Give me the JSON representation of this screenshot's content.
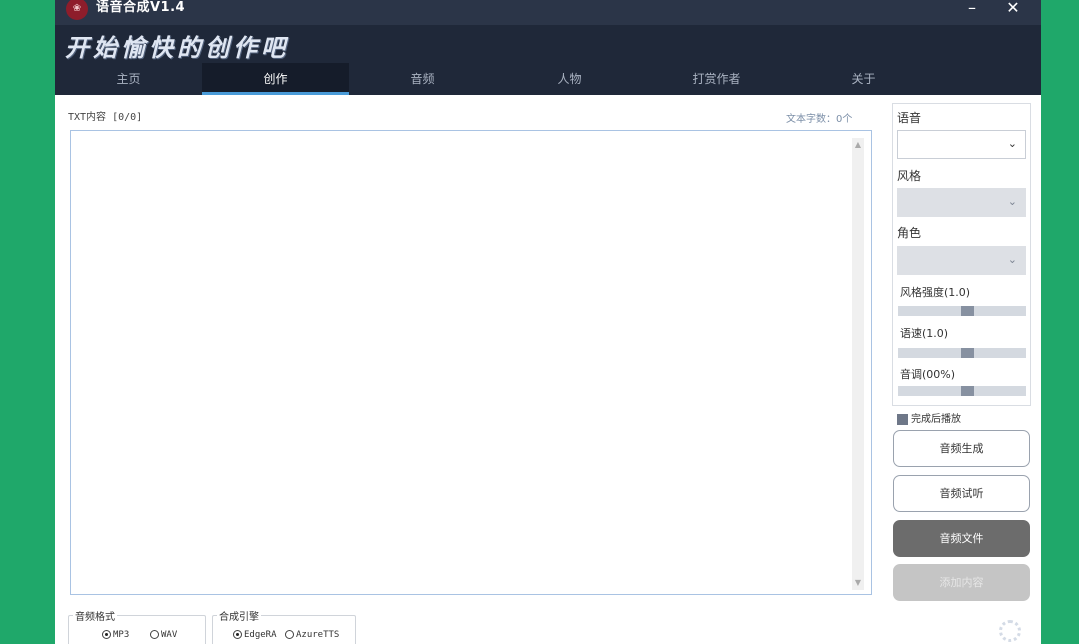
{
  "window": {
    "logo_text": "❀",
    "title": "语音合成V1.4",
    "minimize_label": "–",
    "close_label": "✕",
    "slogan": "开始愉快的创作吧"
  },
  "tabs": [
    {
      "label": "主页",
      "active": false
    },
    {
      "label": "创作",
      "active": true
    },
    {
      "label": "音频",
      "active": false
    },
    {
      "label": "人物",
      "active": false
    },
    {
      "label": "打赏作者",
      "active": false
    },
    {
      "label": "关于",
      "active": false
    }
  ],
  "editor": {
    "txt_label": "TXT内容  [0/0]",
    "char_count": "文本字数：0个",
    "content": ""
  },
  "panel": {
    "voice_label": "语音",
    "voice_value": "",
    "style_label": "风格",
    "style_value": "",
    "role_label": "角色",
    "role_value": "",
    "style_strength_label": "风格强度(1.0)",
    "style_strength_level": 0.54,
    "speed_label": "语速(1.0)",
    "speed_level": 0.54,
    "pitch_label": "音调(00%)",
    "pitch_level": 0.54,
    "play_after_label": "完成后播放",
    "play_after_checked": true
  },
  "buttons": {
    "generate": "音频生成",
    "preview": "音频试听",
    "audio_file": "音频文件",
    "add_content": "添加内容"
  },
  "audio_format": {
    "title": "音频格式",
    "options": [
      {
        "label": "MP3",
        "checked": true
      },
      {
        "label": "WAV",
        "checked": false
      }
    ]
  },
  "engine": {
    "title": "合成引擎",
    "options": [
      {
        "label": "EdgeRA",
        "checked": true
      },
      {
        "label": "AzureTTS",
        "checked": false
      }
    ]
  },
  "colors": {
    "desktop": "#1fa86a",
    "titlebar": "#2b3548",
    "tab_active_underline": "#4a9bd8",
    "dark_button": "#6c6c6c"
  }
}
